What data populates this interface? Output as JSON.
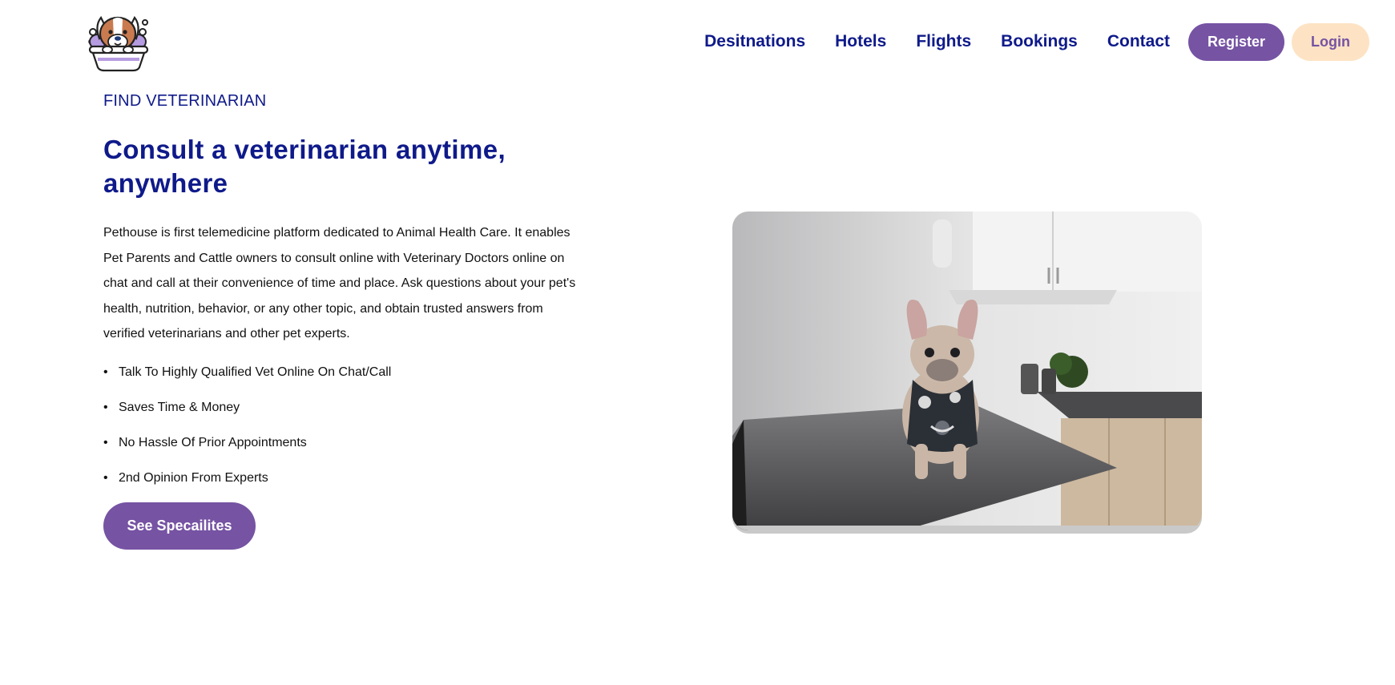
{
  "header": {
    "logo_icon": "dog-in-bathtub-logo-icon",
    "nav": [
      {
        "label": "Desitnations"
      },
      {
        "label": "Hotels"
      },
      {
        "label": "Flights"
      },
      {
        "label": "Bookings"
      },
      {
        "label": "Contact"
      }
    ],
    "register_label": "Register",
    "login_label": "Login"
  },
  "hero": {
    "eyebrow": "FIND VETERINARIAN",
    "title": "Consult a veterinarian anytime, anywhere",
    "description": "Pethouse is first telemedicine platform dedicated to Animal Health Care. It enables Pet Parents and Cattle owners to consult online with Veterinary Doctors online on chat and call at their convenience of time and place. Ask questions about your pet's health, nutrition, behavior, or any other topic, and obtain trusted answers from verified veterinarians and other pet experts.",
    "features": [
      "Talk To Highly Qualified Vet Online On Chat/Call",
      "Saves Time & Money",
      "No Hassle Of Prior Appointments",
      "2nd Opinion From Experts"
    ],
    "cta_label": "See Specailites",
    "image_icon": "french-bulldog-on-exam-table-photo"
  },
  "colors": {
    "primary_purple": "#7653a3",
    "navy": "#0f1a8a",
    "peach": "#fde3c4"
  }
}
